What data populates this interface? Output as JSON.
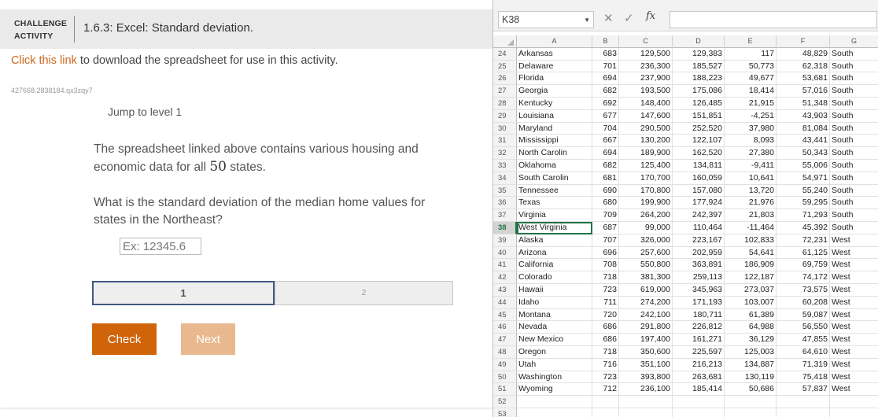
{
  "activity": {
    "badge_line1": "CHALLENGE",
    "badge_line2": "ACTIVITY",
    "title": "1.6.3: Excel: Standard deviation.",
    "intro_link": "Click this link",
    "intro_rest": " to download the spreadsheet for use in this activity.",
    "seed": "427668.2838184.qx3zqy7",
    "jump": "Jump to level 1",
    "q1_before": "The spreadsheet linked above contains various housing and economic data for all ",
    "q1_number": "50",
    "q1_after": " states.",
    "question": "What is the standard deviation of the median home values for states in the Northeast?",
    "answer_placeholder": "Ex: 12345.6",
    "levels": [
      "1",
      "2"
    ],
    "check_label": "Check",
    "next_label": "Next",
    "colors": {
      "accent": "#d0640b",
      "link": "#d0671f",
      "next_disabled": "#eab88e",
      "level_border": "#3d5a80"
    }
  },
  "excel": {
    "namebox": "K38",
    "fx_label": "fx",
    "icons": {
      "cancel": "x-icon",
      "enter": "check-icon",
      "dropdown": "chevron-down-icon"
    },
    "columns": [
      "A",
      "B",
      "C",
      "D",
      "E",
      "F",
      "G"
    ],
    "selected_row": "38",
    "rows": [
      [
        "24",
        "Arkansas",
        "683",
        "129,500",
        "129,383",
        "117",
        "48,829",
        "South"
      ],
      [
        "25",
        "Delaware",
        "701",
        "236,300",
        "185,527",
        "50,773",
        "62,318",
        "South"
      ],
      [
        "26",
        "Florida",
        "694",
        "237,900",
        "188,223",
        "49,677",
        "53,681",
        "South"
      ],
      [
        "27",
        "Georgia",
        "682",
        "193,500",
        "175,086",
        "18,414",
        "57,016",
        "South"
      ],
      [
        "28",
        "Kentucky",
        "692",
        "148,400",
        "126,485",
        "21,915",
        "51,348",
        "South"
      ],
      [
        "29",
        "Louisiana",
        "677",
        "147,600",
        "151,851",
        "-4,251",
        "43,903",
        "South"
      ],
      [
        "30",
        "Maryland",
        "704",
        "290,500",
        "252,520",
        "37,980",
        "81,084",
        "South"
      ],
      [
        "31",
        "Mississippi",
        "667",
        "130,200",
        "122,107",
        "8,093",
        "43,441",
        "South"
      ],
      [
        "32",
        "North Carolin",
        "694",
        "189,900",
        "162,520",
        "27,380",
        "50,343",
        "South"
      ],
      [
        "33",
        "Oklahoma",
        "682",
        "125,400",
        "134,811",
        "-9,411",
        "55,006",
        "South"
      ],
      [
        "34",
        "South Carolin",
        "681",
        "170,700",
        "160,059",
        "10,641",
        "54,971",
        "South"
      ],
      [
        "35",
        "Tennessee",
        "690",
        "170,800",
        "157,080",
        "13,720",
        "55,240",
        "South"
      ],
      [
        "36",
        "Texas",
        "680",
        "199,900",
        "177,924",
        "21,976",
        "59,295",
        "South"
      ],
      [
        "37",
        "Virginia",
        "709",
        "264,200",
        "242,397",
        "21,803",
        "71,293",
        "South"
      ],
      [
        "38",
        "West Virginia",
        "687",
        "99,000",
        "110,464",
        "-11,464",
        "45,392",
        "South"
      ],
      [
        "39",
        "Alaska",
        "707",
        "326,000",
        "223,167",
        "102,833",
        "72,231",
        "West"
      ],
      [
        "40",
        "Arizona",
        "696",
        "257,600",
        "202,959",
        "54,641",
        "61,125",
        "West"
      ],
      [
        "41",
        "California",
        "708",
        "550,800",
        "363,891",
        "186,909",
        "69,759",
        "West"
      ],
      [
        "42",
        "Colorado",
        "718",
        "381,300",
        "259,113",
        "122,187",
        "74,172",
        "West"
      ],
      [
        "43",
        "Hawaii",
        "723",
        "619,000",
        "345,963",
        "273,037",
        "73,575",
        "West"
      ],
      [
        "44",
        "Idaho",
        "711",
        "274,200",
        "171,193",
        "103,007",
        "60,208",
        "West"
      ],
      [
        "45",
        "Montana",
        "720",
        "242,100",
        "180,711",
        "61,389",
        "59,087",
        "West"
      ],
      [
        "46",
        "Nevada",
        "686",
        "291,800",
        "226,812",
        "64,988",
        "56,550",
        "West"
      ],
      [
        "47",
        "New Mexico",
        "686",
        "197,400",
        "161,271",
        "36,129",
        "47,855",
        "West"
      ],
      [
        "48",
        "Oregon",
        "718",
        "350,600",
        "225,597",
        "125,003",
        "64,610",
        "West"
      ],
      [
        "49",
        "Utah",
        "716",
        "351,100",
        "216,213",
        "134,887",
        "71,319",
        "West"
      ],
      [
        "50",
        "Washington",
        "723",
        "393,800",
        "263,681",
        "130,119",
        "75,418",
        "West"
      ],
      [
        "51",
        "Wyoming",
        "712",
        "236,100",
        "185,414",
        "50,686",
        "57,837",
        "West"
      ],
      [
        "52",
        "",
        "",
        "",
        "",
        "",
        "",
        ""
      ],
      [
        "53",
        "",
        "",
        "",
        "",
        "",
        "",
        ""
      ]
    ]
  }
}
